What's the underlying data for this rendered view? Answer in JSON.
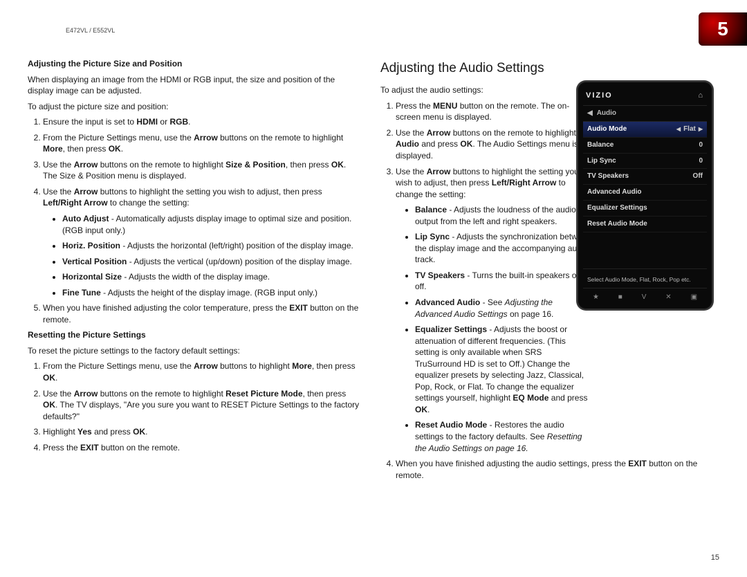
{
  "model_header": "E472VL / E552VL",
  "page_tab": "5",
  "page_number": "15",
  "left": {
    "subhead1": "Adjusting the Picture Size and Position",
    "intro1": "When displaying an image from the HDMI or RGB input, the size and position of the display image can be adjusted.",
    "lead1": "To adjust the picture size and position:",
    "s1": {
      "pre": "Ensure the input is set to ",
      "b1": "HDMI",
      "mid": " or ",
      "b2": "RGB",
      "post": "."
    },
    "s2": {
      "pre": "From the Picture Settings menu, use the ",
      "b1": "Arrow",
      "mid": " buttons on the remote to highlight ",
      "b2": "More",
      "mid2": ", then press ",
      "b3": "OK",
      "post": "."
    },
    "s3": {
      "pre": "Use the ",
      "b1": "Arrow",
      "mid": " buttons on the remote to highlight ",
      "b2": "Size & Position",
      "mid2": ", then press ",
      "b3": "OK",
      "post": ". The Size & Position menu is displayed."
    },
    "s4": {
      "pre": "Use the ",
      "b1": "Arrow",
      "mid": " buttons to highlight the setting you wish to adjust, then press ",
      "b2": "Left/Right Arrow",
      "post": " to change the setting:"
    },
    "b_auto": {
      "b": "Auto Adjust",
      "t": " - Automatically adjusts display image to optimal size and position. (RGB input only.)"
    },
    "b_horiz": {
      "b": "Horiz. Position",
      "t": " - Adjusts the horizontal (left/right) position of the display image."
    },
    "b_vert": {
      "b": "Vertical Position",
      "t": " - Adjusts the vertical (up/down) position of the display image."
    },
    "b_hsize": {
      "b": "Horizontal Size",
      "t": " - Adjusts the width of the display image."
    },
    "b_fine": {
      "b": "Fine Tune",
      "t": " - Adjusts the height of the display image. (RGB input only.)"
    },
    "s5": {
      "pre": "When you have finished adjusting the color temperature, press the ",
      "b1": "EXIT",
      "post": " button on the remote."
    },
    "subhead2": "Resetting the Picture Settings",
    "intro2": "To reset the picture settings to the factory default settings:",
    "r1": {
      "pre": "From the Picture Settings menu, use the ",
      "b1": "Arrow",
      "mid": " buttons to highlight ",
      "b2": "More",
      "mid2": ", then press ",
      "b3": "OK",
      "post": "."
    },
    "r2": {
      "pre": "Use the ",
      "b1": "Arrow",
      "mid": " buttons on the remote to highlight ",
      "b2": "Reset Picture Mode",
      "mid2": ", then press ",
      "b3": "OK",
      "post": ". The TV displays, \"Are you sure you want to RESET Picture Settings to the factory defaults?\""
    },
    "r3": {
      "pre": "Highlight ",
      "b1": "Yes",
      "mid": " and press ",
      "b2": "OK",
      "post": "."
    },
    "r4": {
      "pre": "Press the ",
      "b1": "EXIT",
      "post": " button on the remote."
    }
  },
  "right": {
    "title": "Adjusting the Audio Settings",
    "lead": "To adjust the audio settings:",
    "s1": {
      "pre": "Press the ",
      "b1": "MENU",
      "post": " button on the remote. The on-screen menu is displayed."
    },
    "s2": {
      "pre": "Use the ",
      "b1": "Arrow",
      "mid": " buttons on the remote to highlight ",
      "b2": "Audio",
      "mid2": " and press ",
      "b3": "OK",
      "post": ". The Audio Settings menu is displayed."
    },
    "s3": {
      "pre": "Use the ",
      "b1": "Arrow",
      "mid": " buttons to highlight the setting you wish to adjust, then press ",
      "b2": "Left/Right Arrow",
      "post": " to change the setting:"
    },
    "b_balance": {
      "b": "Balance",
      "t": " - Adjusts the loudness of the audio output from the left and right speakers."
    },
    "b_lipsync": {
      "b": "Lip Sync",
      "t": " - Adjusts the synchronization between the display image and the accompanying audio track."
    },
    "b_tvspk": {
      "b": "TV Speakers",
      "t": " - Turns the built-in speakers on or off."
    },
    "b_adv": {
      "b": "Advanced Audio",
      "t1": " - See ",
      "i": "Adjusting the Advanced Audio Settings",
      "t2": " on page 16."
    },
    "b_eq": {
      "b": "Equalizer Settings",
      "t1": " - Adjusts the boost or attenuation of different frequencies. (This setting is only available when SRS TruSurround HD is set to Off.) Change the equalizer presets by selecting Jazz, Classical, Pop, Rock, or Flat. To change the equalizer settings yourself, highlight ",
      "b2": "EQ Mode",
      "t2": " and press ",
      "b3": "OK",
      "t3": "."
    },
    "b_reset": {
      "b": "Reset Audio Mode",
      "t1": " - Restores the audio settings to the factory defaults. See ",
      "i": "Resetting the Audio Settings on page 16."
    },
    "s4": {
      "pre": "When you have finished adjusting the audio settings, press the ",
      "b1": "EXIT",
      "post": " button on the remote."
    }
  },
  "osd": {
    "brand": "VIZIO",
    "crumb": "Audio",
    "rows": [
      {
        "label": "Audio Mode",
        "value": "Flat",
        "arrows": true,
        "selected": true
      },
      {
        "label": "Balance",
        "value": "0",
        "arrows": false
      },
      {
        "label": "Lip Sync",
        "value": "0",
        "arrows": false
      },
      {
        "label": "TV Speakers",
        "value": "Off",
        "arrows": false
      },
      {
        "label": "Advanced Audio",
        "value": "",
        "arrows": false
      },
      {
        "label": "Equalizer Settings",
        "value": "",
        "arrows": false
      },
      {
        "label": "Reset Audio Mode",
        "value": "",
        "arrows": false
      }
    ],
    "footer": "Select Audio Mode, Flat, Rock, Pop etc.",
    "icons": [
      "★",
      "■",
      "V",
      "✕",
      "▣"
    ]
  }
}
